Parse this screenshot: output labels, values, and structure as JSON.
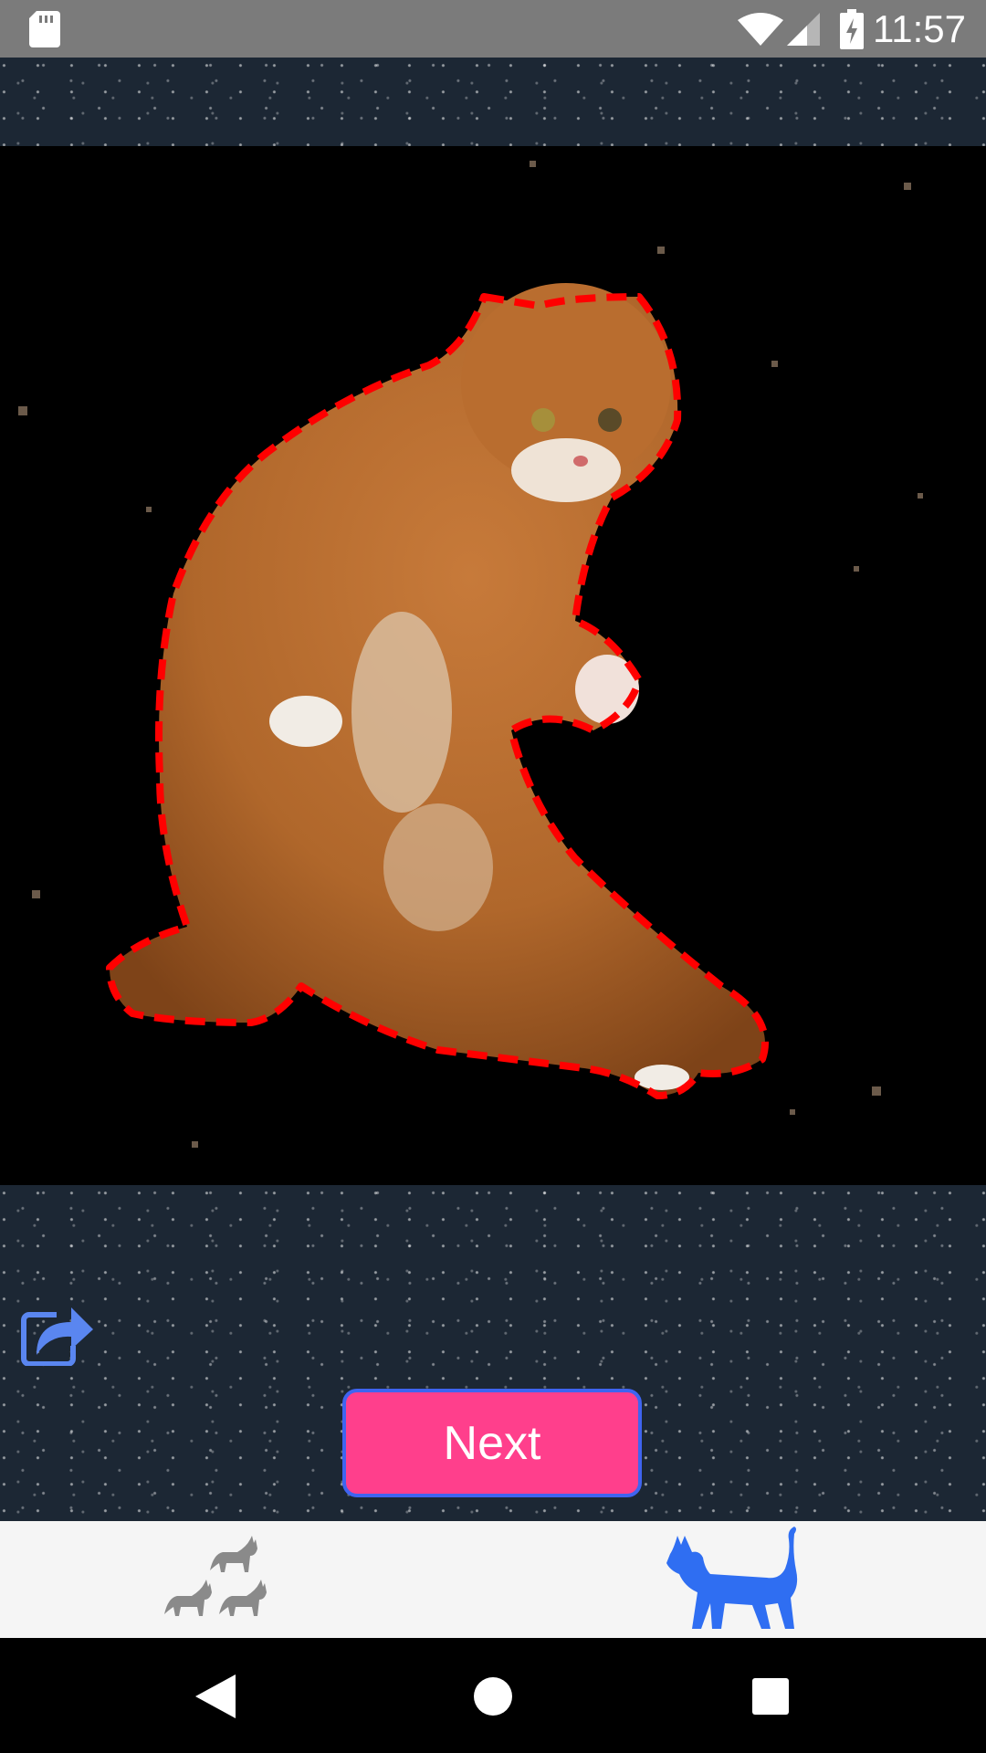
{
  "status_bar": {
    "time": "11:57",
    "icons": [
      "sd-card-icon",
      "wifi-icon",
      "signal-icon",
      "battery-charging-icon"
    ]
  },
  "main": {
    "image_description_icon": "cat-cutout-image",
    "outline_color": "#ff0000",
    "share_icon": "share-icon",
    "next_label": "Next",
    "next_color": "#ff3f8c",
    "next_border_color": "#3f64f0"
  },
  "tabs": [
    {
      "icon": "multiple-cats-icon",
      "active": false
    },
    {
      "icon": "single-cat-icon",
      "active": true
    }
  ],
  "colors": {
    "active_tab": "#2f6ef2",
    "inactive_tab": "#8a8a8a"
  },
  "nav": {
    "icons": [
      "back-icon",
      "home-icon",
      "recents-icon"
    ]
  }
}
